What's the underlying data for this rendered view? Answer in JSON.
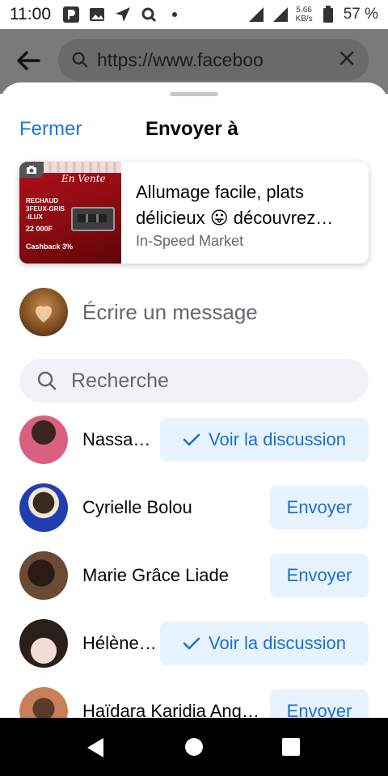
{
  "status_bar": {
    "time": "11:00",
    "net_speed_value": "5.66",
    "net_speed_unit": "KB/s",
    "battery": "57 %"
  },
  "browser": {
    "url": "https://www.faceboo"
  },
  "sheet": {
    "close_label": "Fermer",
    "title": "Envoyer à"
  },
  "preview": {
    "title": "Allumage facile, plats délicieux 😛 découvrez…",
    "source": "In-Speed Market",
    "thumb": {
      "script": "En Vente",
      "text": "RECHAUD 3FEUX-GRIS -ILUX",
      "price": "22 000F",
      "cashback": "Cashback 3%"
    }
  },
  "composer": {
    "placeholder": "Écrire un message"
  },
  "search": {
    "placeholder": "Recherche"
  },
  "contacts": [
    {
      "name": "Nassa…",
      "button": "Voir la discussion",
      "avatar_color": "#d9607f"
    },
    {
      "name": "Cyrielle Bolou",
      "button": "Envoyer",
      "avatar_color": "#1f3fb0"
    },
    {
      "name": "Marie Grâce Liade",
      "button": "Envoyer",
      "avatar_color": "#6b4a36"
    },
    {
      "name": "Hélène…",
      "button": "Voir la discussion",
      "avatar_color": "#2a1f1a"
    },
    {
      "name": "Haïdara Karidia Ang…",
      "button": "Envoyer",
      "avatar_color": "#c9805a"
    }
  ],
  "colors": {
    "accent": "#1b74e4",
    "button_bg": "#e7f3ff",
    "muted_text": "#65676b"
  },
  "icons": [
    "back-arrow-icon",
    "search-icon",
    "close-icon",
    "check-icon",
    "nav-back-icon",
    "nav-home-icon",
    "nav-recents-icon"
  ]
}
